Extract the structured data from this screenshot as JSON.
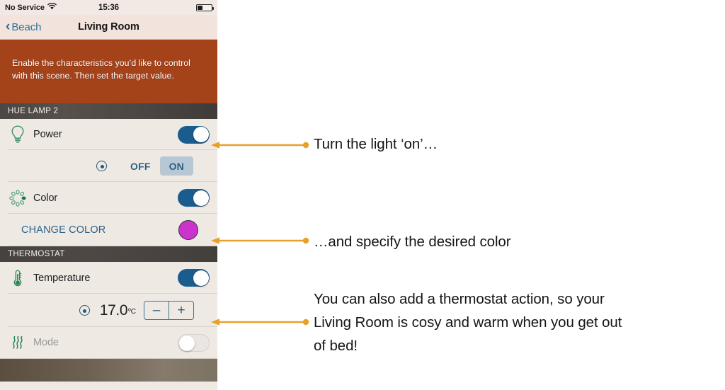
{
  "phone": {
    "status_bar": {
      "carrier": "No Service",
      "wifi_icon": "wifi-icon",
      "time": "15:36",
      "battery_icon": "battery-icon"
    },
    "nav_bar": {
      "back_icon": "chevron-left-icon",
      "back_label": "Beach",
      "title": "Living Room"
    },
    "hero": {
      "instruction": "Enable the characteristics you’d like to control with this scene. Then set the target value."
    },
    "sections": [
      {
        "header": "HUE LAMP 2",
        "rows": [
          {
            "icon": "lightbulb-icon",
            "label": "Power",
            "toggle": "on"
          },
          {
            "icon": "clock-dial-icon",
            "segments": [
              "OFF",
              "ON"
            ],
            "selected": "ON"
          },
          {
            "icon": "color-wheel-icon",
            "label": "Color",
            "toggle": "on"
          },
          {
            "link": "CHANGE COLOR",
            "swatch_color": "#cc33cc"
          }
        ]
      },
      {
        "header": "THERMOSTAT",
        "rows": [
          {
            "icon": "thermometer-icon",
            "label": "Temperature",
            "toggle": "on"
          },
          {
            "icon": "clock-dial-icon",
            "value": "17.0",
            "unit": "ºC",
            "minus": "–",
            "plus": "+"
          },
          {
            "icon": "heat-waves-icon",
            "label": "Mode",
            "toggle": "off"
          }
        ]
      }
    ]
  },
  "annotations": [
    {
      "text": "Turn the light ‘on’…"
    },
    {
      "text": "…and specify the desired color"
    },
    {
      "text": "You can also add a thermostat action, so your\nLiving Room is cosy and warm when you get out\nof bed!"
    }
  ],
  "colors": {
    "accent_orange": "#e8a02a",
    "toggle_blue": "#1b5c8e",
    "link_blue": "#2b6188",
    "icon_green": "#2e8b57",
    "swatch_magenta": "#cc33cc"
  }
}
